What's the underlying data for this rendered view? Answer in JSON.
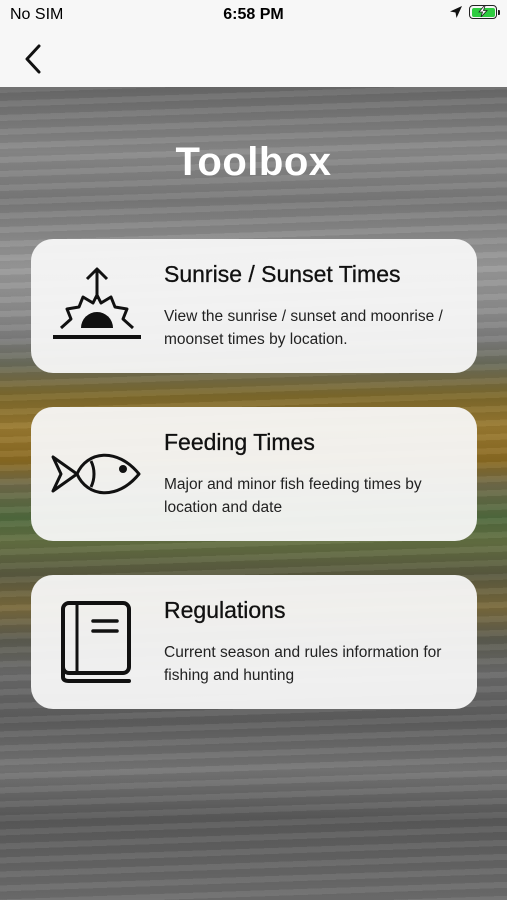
{
  "status_bar": {
    "carrier": "No SIM",
    "time": "6:58 PM",
    "location_icon": "location-arrow-icon",
    "battery_icon": "battery-charging-icon"
  },
  "nav": {
    "back_icon": "chevron-left-icon"
  },
  "page": {
    "title": "Toolbox"
  },
  "cards": [
    {
      "title": "Sunrise / Sunset Times",
      "description": "View the sunrise / sunset and moonrise / moonset times by location.",
      "icon": "sunrise-icon"
    },
    {
      "title": "Feeding Times",
      "description": "Major and minor fish feeding times by location and date",
      "icon": "fish-icon"
    },
    {
      "title": "Regulations",
      "description": "Current season and rules information for fishing and hunting",
      "icon": "book-icon"
    }
  ],
  "colors": {
    "card_background": "#f8f8f8",
    "title_text": "#ffffff",
    "battery_fill": "#2ecc40"
  }
}
